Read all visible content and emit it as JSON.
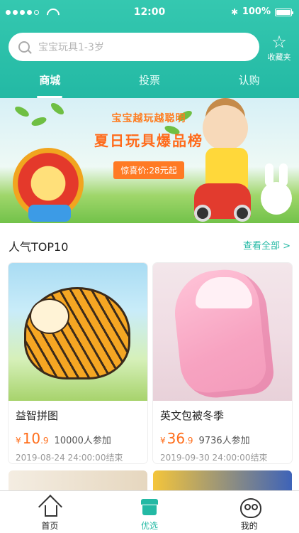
{
  "status_bar": {
    "time": "12:00",
    "battery": "100%",
    "bluetooth_icon": "bluetooth-icon",
    "wifi_icon": "wifi-icon"
  },
  "search": {
    "placeholder": "宝宝玩具1-3岁"
  },
  "favorites": {
    "label": "收藏夹",
    "icon": "star-icon"
  },
  "tabs": [
    {
      "label": "商城",
      "active": true
    },
    {
      "label": "投票",
      "active": false
    },
    {
      "label": "认购",
      "active": false
    }
  ],
  "banner": {
    "line1": "宝宝越玩越聪明",
    "line2": "夏日玩具爆品榜",
    "line3": "惊喜价:28元起"
  },
  "section": {
    "title": "人气TOP10",
    "more": "查看全部 >"
  },
  "products": [
    {
      "title": "益智拼图",
      "currency": "¥",
      "price_int": "10",
      "price_dec": ".9",
      "participants": "10000人参加",
      "end": "2019-08-24 24:00:00结束"
    },
    {
      "title": "英文包被冬季",
      "currency": "¥",
      "price_int": "36",
      "price_dec": ".9",
      "participants": "9736人参加",
      "end": "2019-09-30 24:00:00结束"
    }
  ],
  "bottom_tabs": [
    {
      "label": "首页",
      "icon": "home-icon",
      "active": false
    },
    {
      "label": "优选",
      "icon": "shop-icon",
      "active": true
    },
    {
      "label": "我的",
      "icon": "owl-icon",
      "active": false
    }
  ],
  "colors": {
    "brand": "#23b9a4",
    "price": "#ff6d1a"
  }
}
